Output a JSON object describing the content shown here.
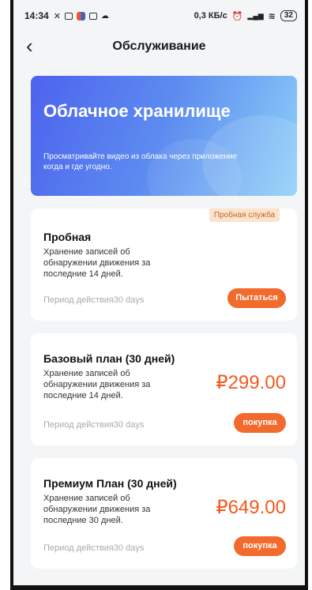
{
  "status_bar": {
    "time": "14:34",
    "network_speed": "0,3 КБ/с",
    "battery": "32"
  },
  "header": {
    "title": "Обслуживание"
  },
  "banner": {
    "title": "Облачное хранилище",
    "subtitle_line1": "Просматривайте видео из облака через приложение",
    "subtitle_line2": "когда и где угодно."
  },
  "plans": [
    {
      "tag": "Пробная служба",
      "name": "Пробная",
      "desc_line1": "Хранение записей об",
      "desc_line2": "обнаружении движения за",
      "desc_line3": "последние 14 дней.",
      "period": "Период действия30 days",
      "button": "Пытаться"
    },
    {
      "name": "Базовый план (30 дней)",
      "desc_line1": "Хранение записей об",
      "desc_line2": "обнаружении движения за",
      "desc_line3": "последние 14 дней.",
      "price": "₽299.00",
      "period": "Период действия30 days",
      "button": "покупка"
    },
    {
      "name": "Премиум План (30 дней)",
      "desc_line1": "Хранение записей об",
      "desc_line2": "обнаружении движения за",
      "desc_line3": "последние 30 дней.",
      "price": "₽649.00",
      "period": "Период действия30 days",
      "button": "покупка"
    }
  ],
  "colors": {
    "accent": "#f26a2c",
    "price": "#f25a1e",
    "banner_start": "#4d63ee",
    "banner_end": "#8ed0f8"
  }
}
